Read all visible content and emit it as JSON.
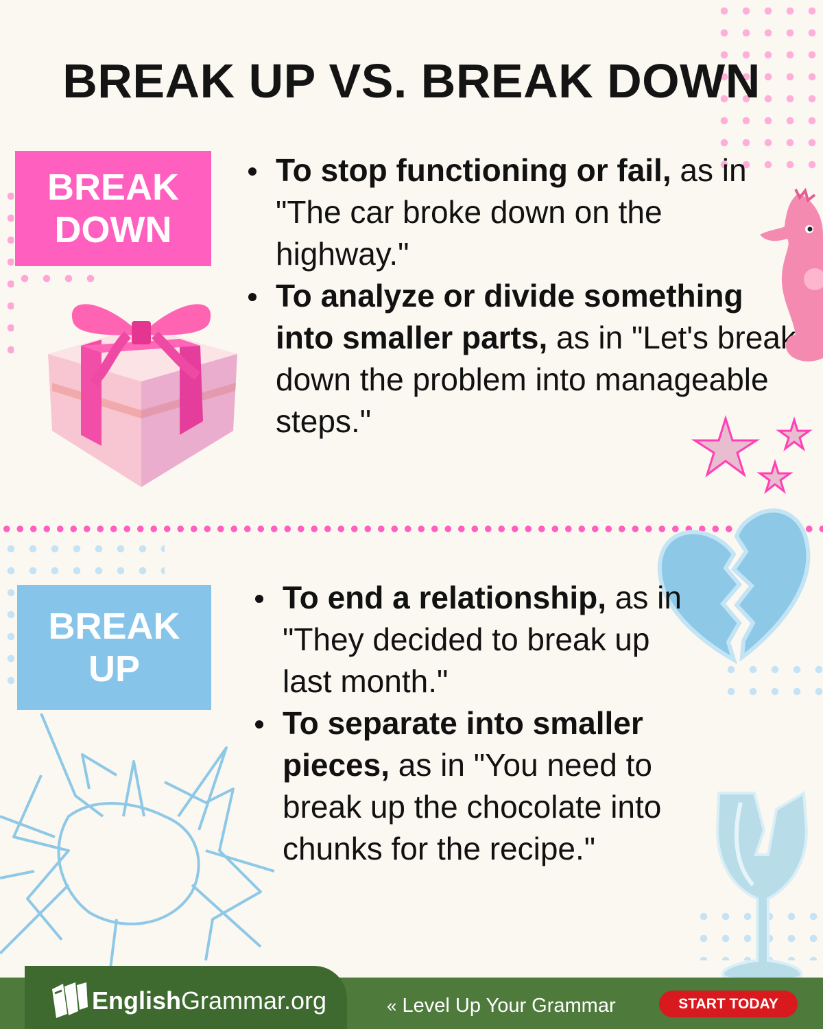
{
  "title": "BREAK UP VS. BREAK DOWN",
  "break_down": {
    "label_line1": "BREAK",
    "label_line2": "DOWN",
    "definitions": [
      {
        "bold": "To stop functioning or fail,",
        "text": " as in \"The car broke down on the highway.\""
      },
      {
        "bold": "To analyze or divide something into smaller parts,",
        "text": " as in \"Let's break down the problem into manageable steps.\""
      }
    ]
  },
  "break_up": {
    "label_line1": "BREAK",
    "label_line2": "UP",
    "definitions": [
      {
        "bold": "To end a relationship,",
        "text": " as in \"They decided to break up last month.\""
      },
      {
        "bold": "To separate into smaller pieces,",
        "text": " as in \"You need to break up the chocolate into chunks for the recipe.\""
      }
    ]
  },
  "footer": {
    "logo_bold": "English",
    "logo_light": "Grammar.org",
    "tagline_icon": "«",
    "tagline": "Level Up Your Grammar",
    "cta": "START TODAY"
  },
  "colors": {
    "pink": "#ff5fbe",
    "blue": "#86c5e9",
    "footer_green": "#4e7a3c",
    "cta_red": "#d8191d",
    "background": "#fbf8f1"
  },
  "icons": [
    "gift-icon",
    "seahorse-icon",
    "stars-icon",
    "broken-heart-icon",
    "cracked-glass-icon",
    "broken-wine-glass-icon",
    "book-logo-icon"
  ]
}
